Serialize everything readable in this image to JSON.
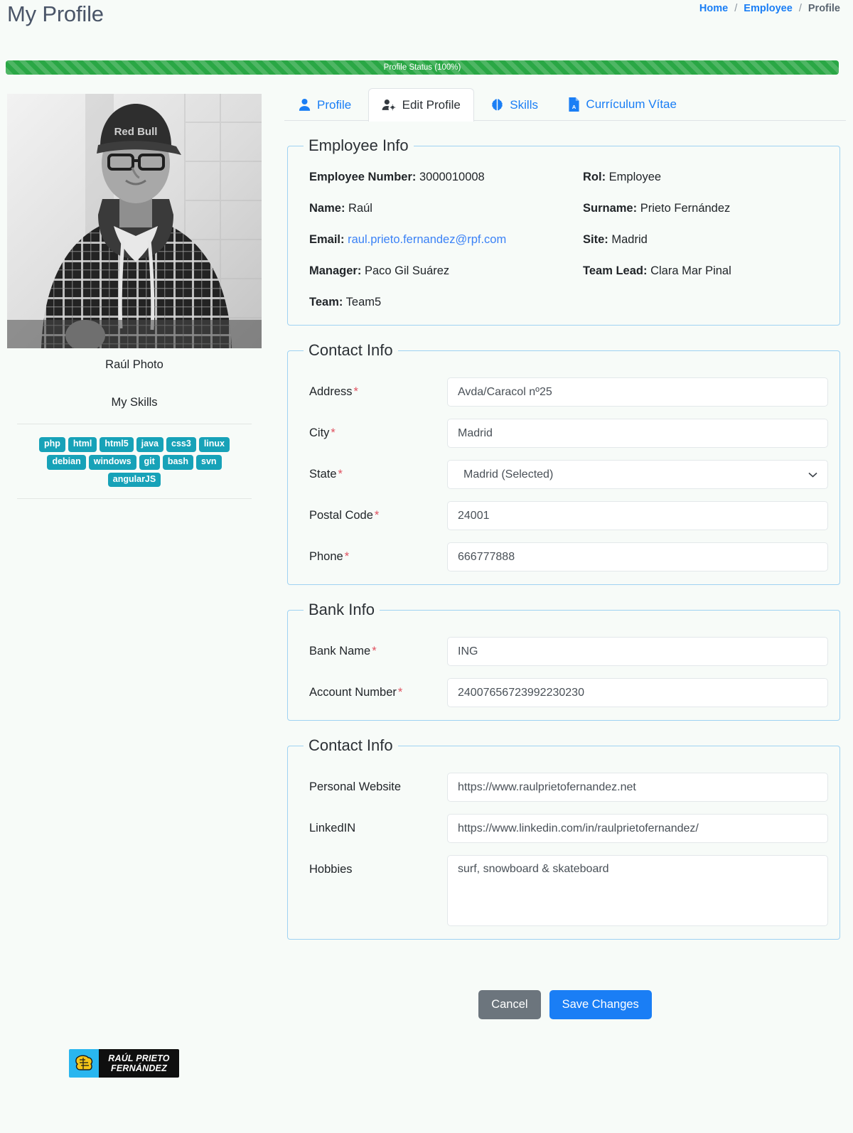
{
  "header": {
    "title": "My Profile",
    "breadcrumb": {
      "home": "Home",
      "employee": "Employee",
      "current": "Profile",
      "separator": "/"
    }
  },
  "progress": {
    "label": "Profile Status (100%)",
    "percent": 100,
    "color": "#2aa745"
  },
  "sidebar": {
    "photo_caption": "Raúl Photo",
    "skills_title": "My Skills",
    "skills": [
      "php",
      "html",
      "html5",
      "java",
      "css3",
      "linux",
      "debian",
      "windows",
      "git",
      "bash",
      "svn",
      "angularJS"
    ],
    "badge_color": "#17a2b8",
    "logo": {
      "line1": "RAÚL PRIETO",
      "line2": "FERNÁNDEZ",
      "mark_bg": "#29b6ef",
      "text_bg": "#0f0f0f"
    }
  },
  "tabs": [
    {
      "label": "Profile",
      "icon": "user-icon",
      "active": false
    },
    {
      "label": "Edit Profile",
      "icon": "user-gear-icon",
      "active": true
    },
    {
      "label": "Skills",
      "icon": "brain-icon",
      "active": false
    },
    {
      "label": "Currículum Vítae",
      "icon": "file-pdf-icon",
      "active": false
    }
  ],
  "employee_info": {
    "legend": "Employee Info",
    "fields": [
      {
        "label": "Employee Number:",
        "value": "3000010008",
        "link": false
      },
      {
        "label": "Rol:",
        "value": "Employee",
        "link": false
      },
      {
        "label": "Name:",
        "value": "Raúl",
        "link": false
      },
      {
        "label": "Surname:",
        "value": "Prieto Fernández",
        "link": false
      },
      {
        "label": "Email:",
        "value": "raul.prieto.fernandez@rpf.com",
        "link": true
      },
      {
        "label": "Site:",
        "value": "Madrid",
        "link": false
      },
      {
        "label": "Manager:",
        "value": "Paco Gil Suárez",
        "link": false
      },
      {
        "label": "Team Lead:",
        "value": "Clara Mar Pinal",
        "link": false
      },
      {
        "label": "Team:",
        "value": "Team5",
        "link": false
      }
    ]
  },
  "contact_info": {
    "legend": "Contact Info",
    "fields": [
      {
        "label": "Address",
        "required": true,
        "value": "Avda/Caracol nº25",
        "type": "text"
      },
      {
        "label": "City",
        "required": true,
        "value": "Madrid",
        "type": "text"
      },
      {
        "label": "State",
        "required": true,
        "value": "Madrid (Selected)",
        "type": "select"
      },
      {
        "label": "Postal Code",
        "required": true,
        "value": "24001",
        "type": "text"
      },
      {
        "label": "Phone",
        "required": true,
        "value": "666777888",
        "type": "text"
      }
    ]
  },
  "bank_info": {
    "legend": "Bank Info",
    "fields": [
      {
        "label": "Bank Name",
        "required": true,
        "value": "ING",
        "type": "text"
      },
      {
        "label": "Account Number",
        "required": true,
        "value": "24007656723992230230",
        "type": "text"
      }
    ]
  },
  "contact_info2": {
    "legend": "Contact Info",
    "fields": [
      {
        "label": "Personal Website",
        "required": false,
        "value": "https://www.raulprietofernandez.net",
        "type": "text"
      },
      {
        "label": "LinkedIN",
        "required": false,
        "value": "https://www.linkedin.com/in/raulprietofernandez/",
        "type": "text"
      },
      {
        "label": "Hobbies",
        "required": false,
        "value": "surf, snowboard & skateboard",
        "type": "textarea"
      }
    ]
  },
  "footer": {
    "cancel_label": "Cancel",
    "save_label": "Save Changes",
    "cancel_color": "#6c757d",
    "save_color": "#1a7ef5"
  }
}
